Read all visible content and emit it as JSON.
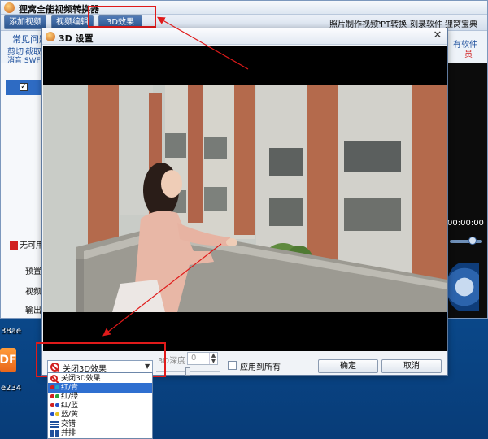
{
  "desktop": {
    "label_top": "38ae",
    "label_bottom": "e234",
    "orange_icon_text": "DF"
  },
  "main_window": {
    "title": "狸窝全能视频转换器",
    "toolbar": {
      "add_video": "添加视频",
      "edit_video": "视频编辑",
      "effect_3d": "3D效果",
      "links": [
        "照片制作视频",
        "PPT转换",
        "刻录软件",
        "狸窝宝典"
      ]
    },
    "subbar": {
      "faq": "常见问题",
      "cut": "剪切",
      "crop": "截取",
      "remove_swf": "消音 SWF",
      "all_software": "有软件",
      "right_red": "员"
    },
    "left_panel": {
      "unavailable": "无可用",
      "preset": "预置",
      "video": "视频",
      "output": "输出"
    },
    "time_readout": "00:00:00"
  },
  "dialog": {
    "title": "3D 设置",
    "close_glyph": "✕",
    "select_value": "关闭3D效果",
    "depth_label": "3D深度",
    "depth_value": "0",
    "apply_all_label": "应用到所有",
    "ok_label": "确定",
    "cancel_label": "取消"
  },
  "dropdown": {
    "items": [
      {
        "label": "关闭3D效果",
        "icon": "no-entry-icon",
        "selected": false
      },
      {
        "label": "红/青",
        "icon": "anaglyph-glasses-icon",
        "colors": [
          "#d12020",
          "#1fa6c9"
        ],
        "selected": true
      },
      {
        "label": "红/绿",
        "icon": "anaglyph-glasses-icon",
        "colors": [
          "#d12020",
          "#2aa33a"
        ],
        "selected": false
      },
      {
        "label": "红/蓝",
        "icon": "anaglyph-glasses-icon",
        "colors": [
          "#d12020",
          "#2652c9"
        ],
        "selected": false
      },
      {
        "label": "蓝/黄",
        "icon": "anaglyph-glasses-icon",
        "colors": [
          "#2652c9",
          "#e6c21f"
        ],
        "selected": false
      },
      {
        "label": "交错",
        "icon": "interlace-icon",
        "selected": false
      },
      {
        "label": "并排",
        "icon": "side-by-side-icon",
        "selected": false
      }
    ]
  },
  "colors": {
    "highlight": "#e01a1a",
    "selection": "#2f6fd0"
  }
}
